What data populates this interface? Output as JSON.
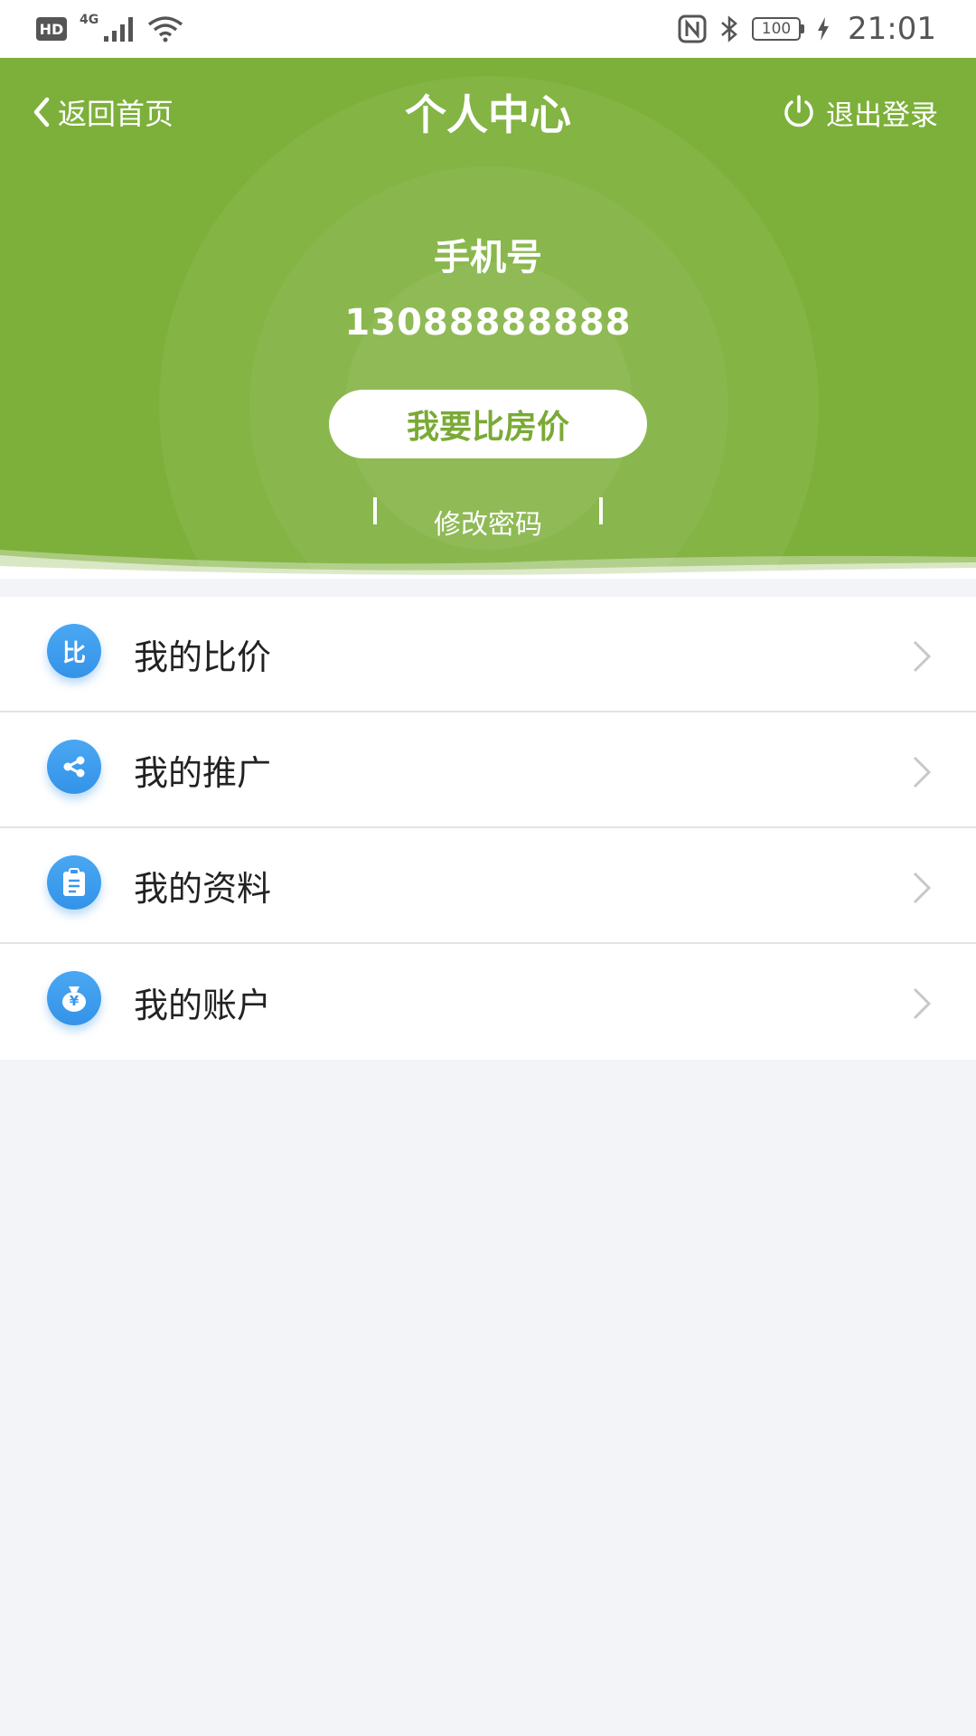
{
  "status_bar": {
    "hd": "HD",
    "network": "4G",
    "battery": "100",
    "time": "21:01"
  },
  "header": {
    "back_label": "返回首页",
    "title": "个人中心",
    "logout_label": "退出登录",
    "phone_label": "手机号",
    "phone_number": "13088888888",
    "compare_button": "我要比房价",
    "change_password": "修改密码",
    "accent_color": "#7db03a"
  },
  "menu": {
    "items": [
      {
        "label": "我的比价",
        "icon": "compare-icon",
        "icon_text": "比"
      },
      {
        "label": "我的推广",
        "icon": "share-icon"
      },
      {
        "label": "我的资料",
        "icon": "clipboard-icon"
      },
      {
        "label": "我的账户",
        "icon": "money-bag-icon",
        "icon_text": "¥"
      }
    ]
  }
}
